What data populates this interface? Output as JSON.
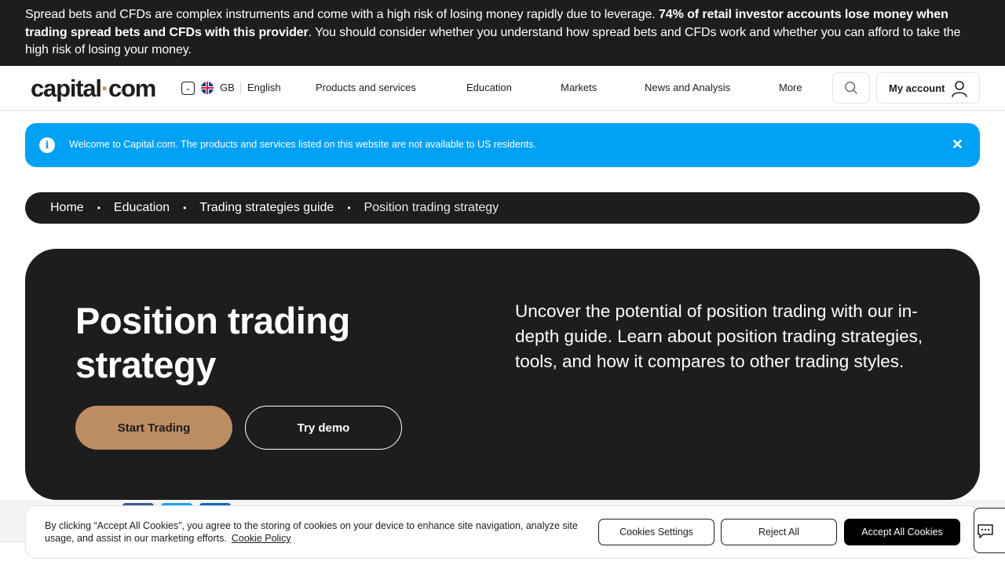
{
  "risk_warning": {
    "part1": "Spread bets and CFDs are complex instruments and come with a high risk of losing money rapidly due to leverage. ",
    "bold": "74% of retail investor accounts lose money when trading spread bets and CFDs with this provider",
    "part2": ". You should consider whether you understand how spread bets and CFDs work and whether you can afford to take the high risk of losing your money."
  },
  "header": {
    "logo_left": "capital",
    "logo_dot": "·",
    "logo_right": "com",
    "region": "GB",
    "language": "English",
    "nav": [
      "Products and services",
      "Education",
      "Markets",
      "News and Analysis",
      "More"
    ],
    "account_label": "My account"
  },
  "notice": {
    "message": "Welcome to Capital.com. The products and services listed on this website are not available to US residents.",
    "close": "✕"
  },
  "breadcrumb": [
    "Home",
    "Education",
    "Trading strategies guide",
    "Position trading strategy"
  ],
  "hero": {
    "title": "Position trading strategy",
    "description": "Uncover the potential of position trading with our in-depth guide. Learn about position trading strategies, tools, and how it compares to other trading styles.",
    "primary_button": "Start Trading",
    "secondary_button": "Try demo"
  },
  "cookie_banner": {
    "text": "By clicking “Accept All Cookies”, you agree to the storing of cookies on your device to enhance site navigation, analyze site usage, and assist in our marketing efforts.",
    "policy_link": "Cookie Policy",
    "settings_button": "Cookies Settings",
    "reject_button": "Reject All",
    "accept_button": "Accept All Cookies"
  },
  "colors": {
    "dark": "#1d1d1d",
    "accent": "#bc8c62",
    "notice_blue": "#00a0f5"
  }
}
